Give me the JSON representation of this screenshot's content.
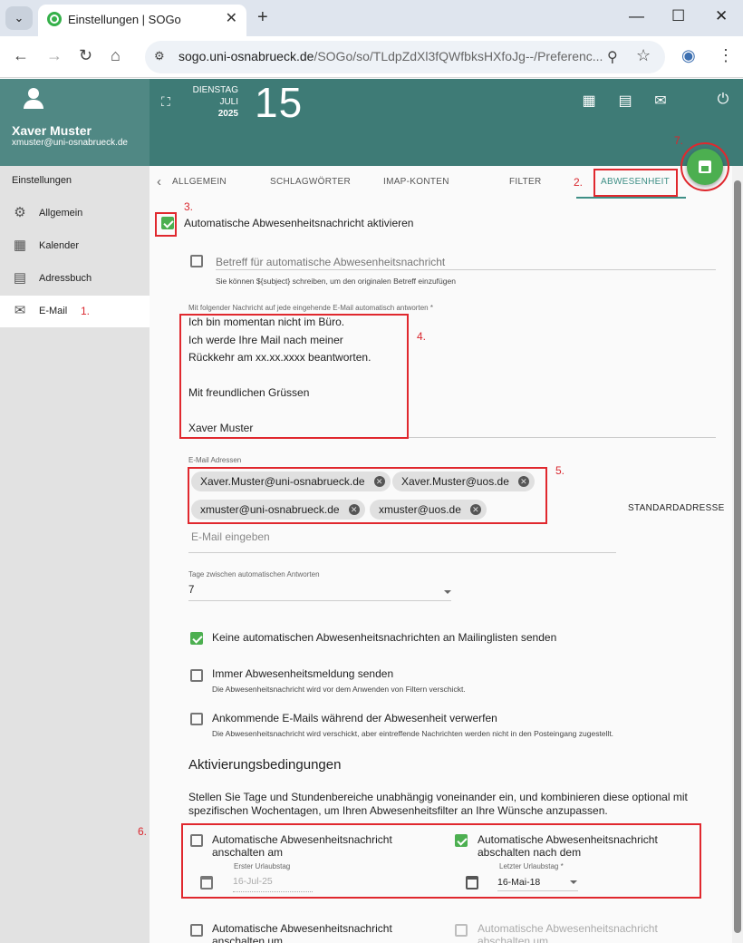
{
  "browser": {
    "tab_title": "Einstellungen | SOGo",
    "url_host": "sogo.uni-osnabrueck.de",
    "url_path": "/SOGo/so/TLdpZdXl3fQWfbksHXfoJg--/Preferenc...",
    "close_glyph": "✕",
    "newtab_glyph": "+",
    "dropdown_glyph": "⌄",
    "min_glyph": "—",
    "max_glyph": "☐",
    "winclose_glyph": "✕",
    "back_glyph": "←",
    "forward_glyph": "→",
    "reload_glyph": "↻",
    "home_glyph": "⌂",
    "zoom_glyph": "⚲",
    "star_glyph": "☆",
    "profile_glyph": "◉",
    "menu_glyph": "⋮",
    "tune_glyph": "⚙"
  },
  "header": {
    "user_name": "Xaver Muster",
    "user_email": "xmuster@uni-osnabrueck.de",
    "weekday": "DIENSTAG",
    "month": "JULI",
    "year": "2025",
    "day": "15",
    "expand_glyph": "⛶",
    "cal_glyph": "▦",
    "contacts_glyph": "▤",
    "mail_glyph": "✉",
    "power_glyph": "⏻"
  },
  "sidebar": {
    "title": "Einstellungen",
    "items": [
      {
        "label": "Allgemein",
        "icon": "gear-icon",
        "glyph": "⚙"
      },
      {
        "label": "Kalender",
        "icon": "calendar-icon",
        "glyph": "▦"
      },
      {
        "label": "Adressbuch",
        "icon": "addressbook-icon",
        "glyph": "▤"
      },
      {
        "label": "E-Mail",
        "icon": "mail-icon",
        "glyph": "✉"
      }
    ]
  },
  "tabs": {
    "back_glyph": "‹",
    "items": [
      "ALLGEMEIN",
      "SCHLAGWÖRTER",
      "IMAP-KONTEN",
      "FILTER",
      "ABWESENHEIT"
    ]
  },
  "vacation": {
    "enable_label": "Automatische Abwesenheitsnachricht aktivieren",
    "subject_placeholder": "Betreff für automatische Abwesenheitsnachricht",
    "subject_hint": "Sie können ${subject} schreiben, um den originalen Betreff einzufügen",
    "message_label": "Mit folgender Nachricht auf jede eingehende E-Mail automatisch antworten",
    "required_mark": "*",
    "message": "Ich bin momentan nicht im Büro.\nIch werde Ihre Mail nach meiner\nRückkehr am xx.xx.xxxx beantworten.\n\nMit freundlichen Grüssen\n\nXaver Muster",
    "addresses_label": "E-Mail Adressen",
    "addresses": [
      "Xaver.Muster@uni-osnabrueck.de",
      "Xaver.Muster@uos.de",
      "xmuster@uni-osnabrueck.de",
      "xmuster@uos.de"
    ],
    "chip_remove_glyph": "✕",
    "address_placeholder": "E-Mail eingeben",
    "default_address_button": "STANDARDADRESSE",
    "days_label": "Tage zwischen automatischen Antworten",
    "days_value": "7",
    "no_lists_label": "Keine automatischen Abwesenheitsnachrichten an Mailinglisten senden",
    "always_label": "Immer Abwesenheitsmeldung senden",
    "always_hint": "Die Abwesenheitsnachricht wird vor dem Anwenden von Filtern verschickt.",
    "discard_label": "Ankommende E-Mails während der Abwesenheit verwerfen",
    "discard_hint": "Die Abwesenheitsnachricht wird verschickt, aber eintreffende Nachrichten werden nicht in den Posteingang zugestellt.",
    "activation_heading": "Aktivierungsbedingungen",
    "activation_text": "Stellen Sie Tage und Stundenbereiche unabhängig voneinander ein, und kombinieren diese optional mit spezifischen Wochentagen, um Ihren Abwesenheitsfilter an Ihre Wünsche anzupassen.",
    "start_label": "Automatische Abwesenheitsnachricht anschalten am",
    "start_field_label": "Erster Urlaubstag",
    "start_value": "16-Jul-25",
    "end_label": "Automatische Abwesenheitsnachricht abschalten nach dem",
    "end_field_label": "Letzter Urlaubstag",
    "end_value": "16-Mai-18",
    "time_on_label": "Automatische Abwesenheitsnachricht anschalten um",
    "time_off_label": "Automatische Abwesenheitsnachricht abschalten um"
  },
  "annotations": [
    "1.",
    "2.",
    "3.",
    "4.",
    "5.",
    "6.",
    "7."
  ],
  "colors": {
    "accent": "#3e8f86",
    "header": "#3e7b76",
    "annotation": "#e0282e",
    "fab": "#4caf50"
  }
}
